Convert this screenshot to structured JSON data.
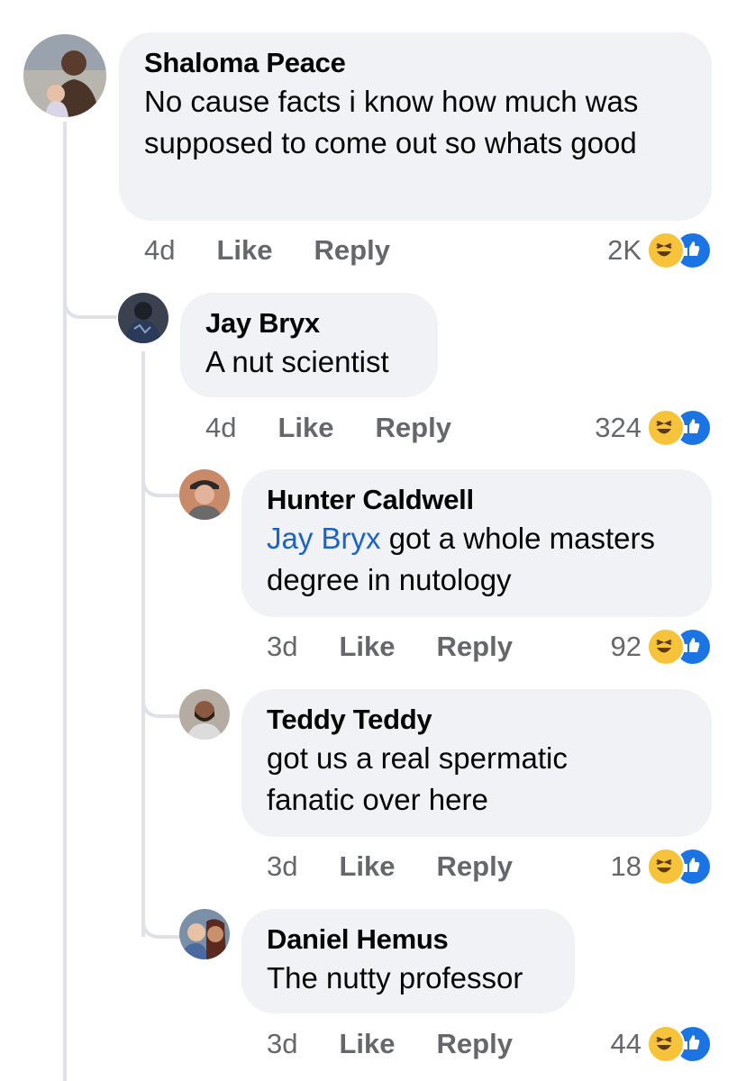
{
  "comments": [
    {
      "author": "Shaloma Peace",
      "text": "No cause facts i know how much was supposed to come out so whats good",
      "time": "4d",
      "like": "Like",
      "reply": "Reply",
      "reactions": "2K",
      "avatar_color": "#8a7a6a"
    },
    {
      "author": "Jay Bryx",
      "text": "A nut scientist",
      "time": "4d",
      "like": "Like",
      "reply": "Reply",
      "reactions": "324",
      "avatar_color": "#2c3340"
    },
    {
      "author": "Hunter Caldwell",
      "mention": "Jay Bryx",
      "text": " got a whole masters degree in nutology",
      "time": "3d",
      "like": "Like",
      "reply": "Reply",
      "reactions": "92",
      "avatar_color": "#9a6b55"
    },
    {
      "author": "Teddy Teddy",
      "text": "got us a real spermatic fanatic over here",
      "time": "3d",
      "like": "Like",
      "reply": "Reply",
      "reactions": "18",
      "avatar_color": "#7d7d7d"
    },
    {
      "author": "Daniel Hemus",
      "text": "The nutty professor",
      "time": "3d",
      "like": "Like",
      "reply": "Reply",
      "reactions": "44",
      "avatar_color": "#a0785f"
    }
  ],
  "reaction_icons": [
    "haha-icon",
    "like-icon"
  ],
  "colors": {
    "bubble": "#f0f2f5",
    "mention": "#1a63c9",
    "meta": "#65676b",
    "thread": "#dfe1e6"
  }
}
